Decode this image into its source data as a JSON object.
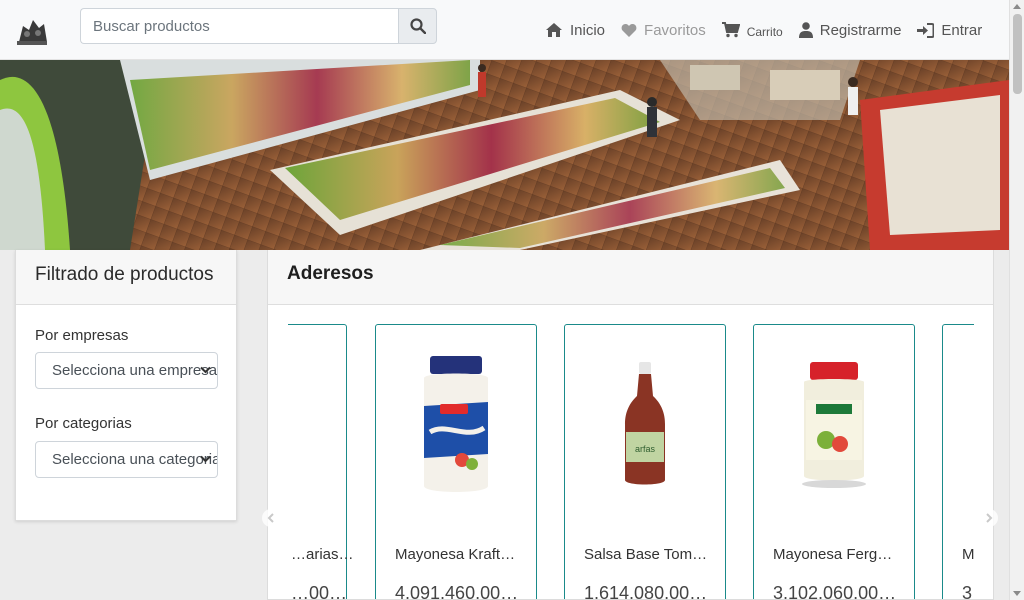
{
  "search": {
    "placeholder": "Buscar productos"
  },
  "nav": {
    "inicio": "Inicio",
    "favoritos": "Favoritos",
    "carrito": "Carrito",
    "registrarme": "Registrarme",
    "entrar": "Entrar"
  },
  "filter": {
    "title": "Filtrado de productos",
    "companies_label": "Por empresas",
    "companies_selected": "Selecciona una empresa",
    "categories_label": "Por categorias",
    "categories_selected": "Selecciona una categoria"
  },
  "section": {
    "title": "Aderesos"
  },
  "products": [
    {
      "name": "…arias…",
      "price": "…00…"
    },
    {
      "name": "Mayonesa Kraft …",
      "price": "4,091,460.00…"
    },
    {
      "name": "Salsa Base Tom…",
      "price": "1,614,080.00…"
    },
    {
      "name": "Mayonesa Ferg…",
      "price": "3,102,060.00…"
    },
    {
      "name": "M…",
      "price": "3…"
    }
  ],
  "colors": {
    "card_border": "#1a8a8a",
    "nav_text": "#555555",
    "nav_muted": "#9a9a9a"
  }
}
